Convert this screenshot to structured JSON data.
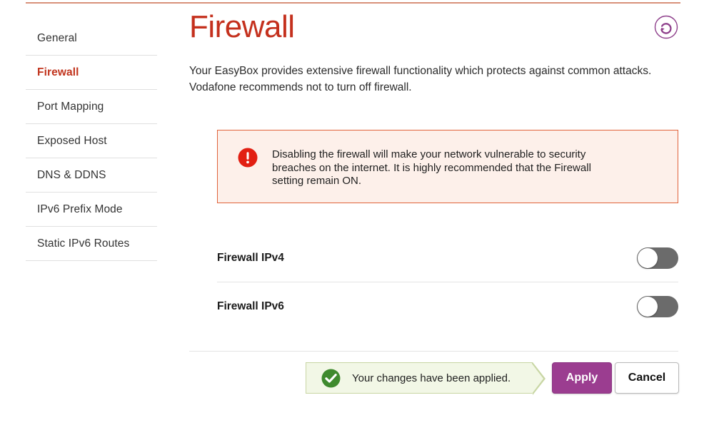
{
  "theme": {
    "accent_red": "#c4301d",
    "accent_purple": "#9b3d90",
    "warning_bg": "#fdf0ea",
    "warning_border": "#e0623a",
    "warning_icon": "#e21f12",
    "success_bg": "#f2f7e6",
    "success_border": "#c8d6a4",
    "success_icon": "#3f8a2e",
    "toggle_off_track": "#6b6b6b",
    "top_rule": "#d8917a"
  },
  "sidebar": {
    "items": [
      {
        "label": "General",
        "active": false
      },
      {
        "label": "Firewall",
        "active": true
      },
      {
        "label": "Port Mapping",
        "active": false
      },
      {
        "label": "Exposed Host",
        "active": false
      },
      {
        "label": "DNS & DDNS",
        "active": false
      },
      {
        "label": "IPv6 Prefix Mode",
        "active": false
      },
      {
        "label": "Static IPv6 Routes",
        "active": false
      }
    ]
  },
  "main": {
    "title": "Firewall",
    "refresh_icon": "refresh-icon",
    "intro_line1": "Your EasyBox provides extensive firewall functionality which protects against common attacks.",
    "intro_line2": "Vodafone recommends not to turn off firewall.",
    "warning": {
      "icon": "alert-exclamation-icon",
      "line1": "Disabling the firewall will make your network vulnerable to security",
      "line2": "breaches on the internet. It is highly recommended that the Firewall",
      "line3": "setting remain ON."
    },
    "settings": [
      {
        "label": "Firewall IPv4",
        "state": "off"
      },
      {
        "label": "Firewall IPv6",
        "state": "off"
      }
    ],
    "footer": {
      "success_icon": "check-circle-icon",
      "success_message": "Your changes have been applied.",
      "apply_label": "Apply",
      "cancel_label": "Cancel"
    }
  }
}
